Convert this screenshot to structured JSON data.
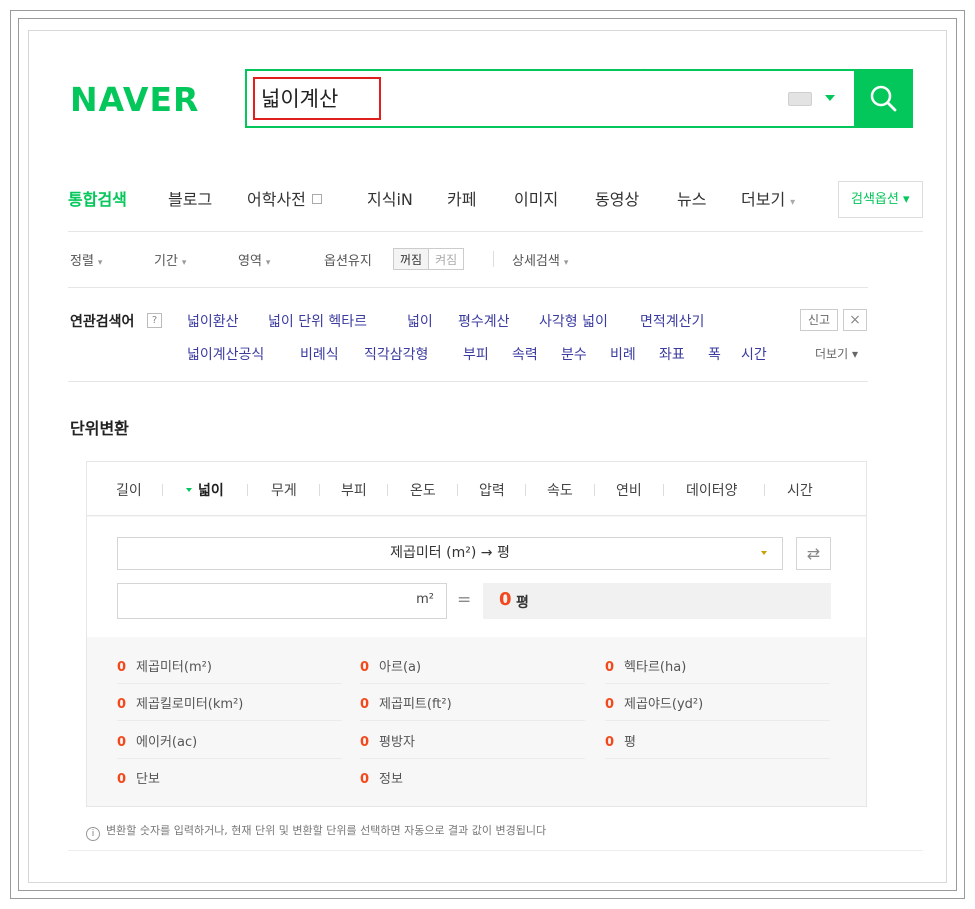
{
  "logo": {
    "text": "NAVER"
  },
  "search": {
    "query": "넓이계산",
    "button_label": "검색"
  },
  "tabs": [
    {
      "label": "통합검색",
      "active": true
    },
    {
      "label": "블로그"
    },
    {
      "label": "어학사전"
    },
    {
      "label": "지식iN"
    },
    {
      "label": "카페"
    },
    {
      "label": "이미지"
    },
    {
      "label": "동영상"
    },
    {
      "label": "뉴스"
    },
    {
      "label": "더보기"
    }
  ],
  "search_option": {
    "label": "검색옵션"
  },
  "filters": {
    "sort": "정렬",
    "period": "기간",
    "area": "영역",
    "keep_option": "옵션유지",
    "toggle_off": "꺼짐",
    "toggle_on": "켜짐",
    "advanced": "상세검색"
  },
  "related": {
    "title": "연관검색어",
    "help": "?",
    "report": "신고",
    "close": "×",
    "more": "더보기",
    "row1": [
      "넓이환산",
      "넓이 단위 헥타르",
      "넓이",
      "평수계산",
      "사각형 넓이",
      "면적계산기"
    ],
    "row2": [
      "넓이계산공식",
      "비례식",
      "직각삼각형",
      "부피",
      "속력",
      "분수",
      "비례",
      "좌표",
      "폭",
      "시간"
    ]
  },
  "converter": {
    "section_title": "단위변환",
    "categories": [
      "길이",
      "넓이",
      "무게",
      "부피",
      "온도",
      "압력",
      "속도",
      "연비",
      "데이터양",
      "시간"
    ],
    "active_category": "넓이",
    "selected_conversion": "제곱미터 (m²) → 평",
    "input_value": "",
    "input_unit": "m²",
    "equals": "=",
    "result_value": "0",
    "result_unit": "평",
    "results": [
      [
        "0",
        "제곱미터(m²)"
      ],
      [
        "0",
        "아르(a)"
      ],
      [
        "0",
        "헥타르(ha)"
      ],
      [
        "0",
        "제곱킬로미터(km²)"
      ],
      [
        "0",
        "제곱피트(ft²)"
      ],
      [
        "0",
        "제곱야드(yd²)"
      ],
      [
        "0",
        "에이커(ac)"
      ],
      [
        "0",
        "평방자"
      ],
      [
        "0",
        "평"
      ],
      [
        "0",
        "단보"
      ],
      [
        "0",
        "정보"
      ]
    ],
    "notice": "변환할 숫자를 입력하거나, 현재 단위 및 변환할 단위를 선택하면 자동으로 결과 값이 변경됩니다"
  },
  "colors": {
    "brand": "#03c75a",
    "highlight": "#e0201e",
    "result": "#f2481b",
    "link": "#3b3ba0"
  }
}
